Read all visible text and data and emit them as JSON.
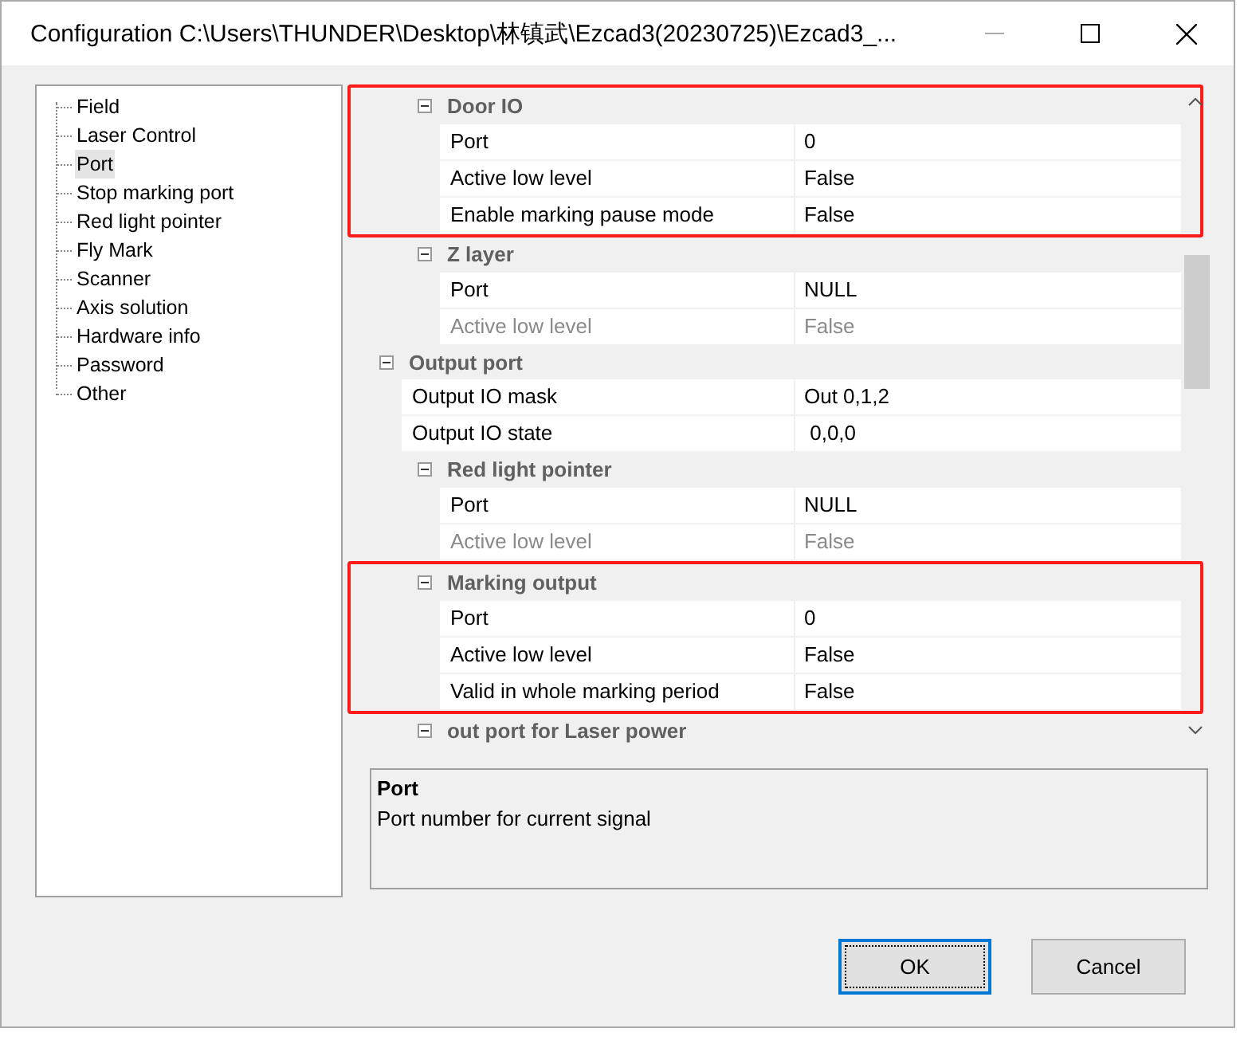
{
  "window": {
    "title": "Configuration C:\\Users\\THUNDER\\Desktop\\林镇武\\Ezcad3(20230725)\\Ezcad3_..."
  },
  "sidebar": {
    "items": [
      {
        "label": "Field",
        "selected": false
      },
      {
        "label": "Laser Control",
        "selected": false
      },
      {
        "label": "Port",
        "selected": true
      },
      {
        "label": "Stop marking port",
        "selected": false
      },
      {
        "label": "Red light pointer",
        "selected": false
      },
      {
        "label": "Fly Mark",
        "selected": false
      },
      {
        "label": "Scanner",
        "selected": false
      },
      {
        "label": "Axis solution",
        "selected": false
      },
      {
        "label": "Hardware info",
        "selected": false
      },
      {
        "label": "Password",
        "selected": false
      },
      {
        "label": "Other",
        "selected": false
      }
    ]
  },
  "property_grid": {
    "groups": [
      {
        "kind": "subgroup",
        "label": "Door IO",
        "highlighted": true,
        "rows": [
          {
            "name": "Port",
            "value": "0",
            "disabled": false
          },
          {
            "name": "Active low level",
            "value": "False",
            "disabled": false
          },
          {
            "name": "Enable marking pause mode",
            "value": "False",
            "disabled": false
          }
        ]
      },
      {
        "kind": "subgroup",
        "label": "Z layer",
        "highlighted": false,
        "rows": [
          {
            "name": "Port",
            "value": "NULL",
            "disabled": false
          },
          {
            "name": "Active low level",
            "value": "False",
            "disabled": true
          }
        ]
      },
      {
        "kind": "group",
        "label": "Output port",
        "highlighted": false,
        "rows": [
          {
            "name": "Output IO mask",
            "value": "Out 0,1,2",
            "disabled": false
          },
          {
            "name": "Output IO state",
            "value": " 0,0,0",
            "disabled": false
          }
        ],
        "children": [
          {
            "kind": "subgroup",
            "label": "Red light pointer",
            "highlighted": false,
            "rows": [
              {
                "name": "Port",
                "value": "NULL",
                "disabled": false
              },
              {
                "name": "Active low level",
                "value": "False",
                "disabled": true
              }
            ]
          },
          {
            "kind": "subgroup",
            "label": "Marking output",
            "highlighted": true,
            "rows": [
              {
                "name": "Port",
                "value": "0",
                "disabled": false
              },
              {
                "name": "Active low level",
                "value": "False",
                "disabled": false
              },
              {
                "name": "Valid in whole marking period",
                "value": "False",
                "disabled": false
              }
            ]
          },
          {
            "kind": "subgroup",
            "label": "out port for Laser power",
            "highlighted": false
          }
        ]
      }
    ]
  },
  "description": {
    "title": "Port",
    "text": "Port number for current signal"
  },
  "buttons": [
    {
      "label": "OK",
      "default": true
    },
    {
      "label": "Cancel",
      "default": false
    }
  ]
}
